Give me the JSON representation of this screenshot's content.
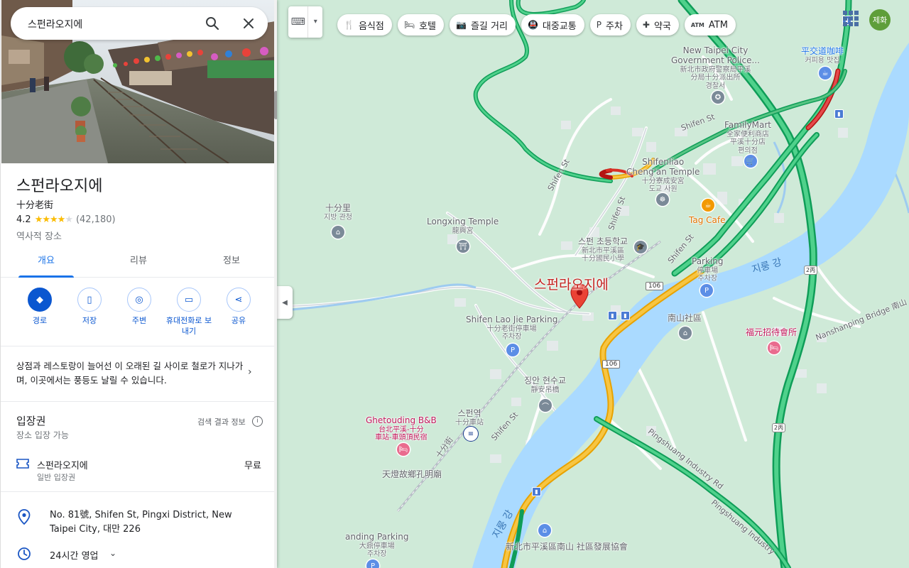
{
  "search": {
    "value": "스펀라오지에"
  },
  "place": {
    "name": "스펀라오지에",
    "alt_name": "十分老街",
    "rating": "4.2",
    "stars": 4,
    "review_count": "(42,180)",
    "category": "역사적 장소"
  },
  "tabs": [
    {
      "label": "개요",
      "active": true
    },
    {
      "label": "리뷰",
      "active": false
    },
    {
      "label": "정보",
      "active": false
    }
  ],
  "actions": [
    {
      "label": "경로",
      "icon": "directions-icon"
    },
    {
      "label": "저장",
      "icon": "bookmark-icon"
    },
    {
      "label": "주변",
      "icon": "nearby-icon"
    },
    {
      "label": "휴대전화로 보내기",
      "icon": "send-to-phone-icon"
    },
    {
      "label": "공유",
      "icon": "share-icon"
    }
  ],
  "description": "상점과 레스토랑이 늘어선 이 오래된 길 사이로 철로가 지나가며, 이곳에서는 풍등도 날릴 수 있습니다.",
  "admission": {
    "title": "입장권",
    "subtitle": "장소 입장 가능",
    "info_label": "검색 결과 정보",
    "ticket_name": "스펀라오지에",
    "ticket_type": "일반 입장권",
    "ticket_price": "무료"
  },
  "address": "No. 81號, Shifen St, Pingxi District, New Taipei City, 대만 226",
  "hours": "24시간 영업",
  "map": {
    "pin_label": "스펀라오지에",
    "chips": [
      {
        "label": "음식점",
        "icon": "restaurant-icon",
        "glyph": "🍴"
      },
      {
        "label": "호텔",
        "icon": "hotel-icon",
        "glyph": "🛏"
      },
      {
        "label": "즐길 거리",
        "icon": "camera-icon",
        "glyph": "📷"
      },
      {
        "label": "대중교통",
        "icon": "transit-icon",
        "glyph": "🚇"
      },
      {
        "label": "주차",
        "icon": "parking-icon",
        "glyph": "P"
      },
      {
        "label": "약국",
        "icon": "pharmacy-icon",
        "glyph": "✚"
      },
      {
        "label": "ATM",
        "icon": "atm-icon",
        "glyph": "ATM"
      }
    ],
    "avatar": "제화",
    "labels": {
      "gov_police": "New Taipei City\nGovernment Police...",
      "gov_police_sub": "新北市政府警察局平溪\n分局十分派出所\n경찰서",
      "cafe_top": "平交道咖啡",
      "cafe_top_sub": "커피용 맛집",
      "family_mart": "FamilyMart",
      "family_mart_sub": "全家便利商店\n平溪十分店\n편의점",
      "chengan": "Shifenliao\nCheng'an Temple",
      "chengan_sub": "十分寮成安宮\n도교 사원",
      "tag_cafe": "Tag Cafe",
      "shifenli": "十分里",
      "shifenli_sub": "지방 관청",
      "longxing": "Longxing Temple",
      "longxing_sub": "龍興宮",
      "school": "스펀 초등학교",
      "school_sub": "新北市平溪區\n十分國民小學",
      "parking_right": "Parking",
      "parking_right_sub": "停車場\n주차장",
      "laojie_parking": "Shifen Lao Jie Parking",
      "laojie_parking_sub": "十分老街停車場\n주차장",
      "nanshan": "南山社區",
      "fuyuan": "福元招待會所",
      "xianshui": "징안 현수교",
      "xianshui_sub": "靜安吊橋",
      "station": "스펀역",
      "station_sub": "十分車站",
      "ghetouding": "Ghetouding B&B",
      "ghetouding_sub": "台北平溪-十分\n車站-車頭頂民宿",
      "tiandeng": "天燈故鄉孔明廟",
      "bottom_parking": "anding Parking",
      "bottom_parking_sub": "大鼎停車場\n주차장",
      "bottom_dev": "新北市平溪區南山\n社區發展協會"
    },
    "rivers": {
      "jilong1": "지룽 강",
      "jilong2": "지룽 강"
    },
    "roads": {
      "shifen_st_1": "Shifen St",
      "shifen_st_2": "Shifen St",
      "shifen_st_3": "Shifen St",
      "shifen_st_4": "Shifen St",
      "shifen_st_5": "Shifen St",
      "shifen_jie": "十分街",
      "pingshuang1": "Pingshuang Industry Rd",
      "pingshuang2": "Pingshuang Industry",
      "nanshanping": "Nanshanping Bridge 南山"
    },
    "shields": {
      "r106a": "106",
      "r106b": "106",
      "r2a": "2丙",
      "r2b": "2丙",
      "r2c": "2丙"
    }
  },
  "colors": {
    "accent": "#1a73e8",
    "pin": "#ea4335",
    "highway": "#1db954",
    "river": "#aadaff"
  }
}
